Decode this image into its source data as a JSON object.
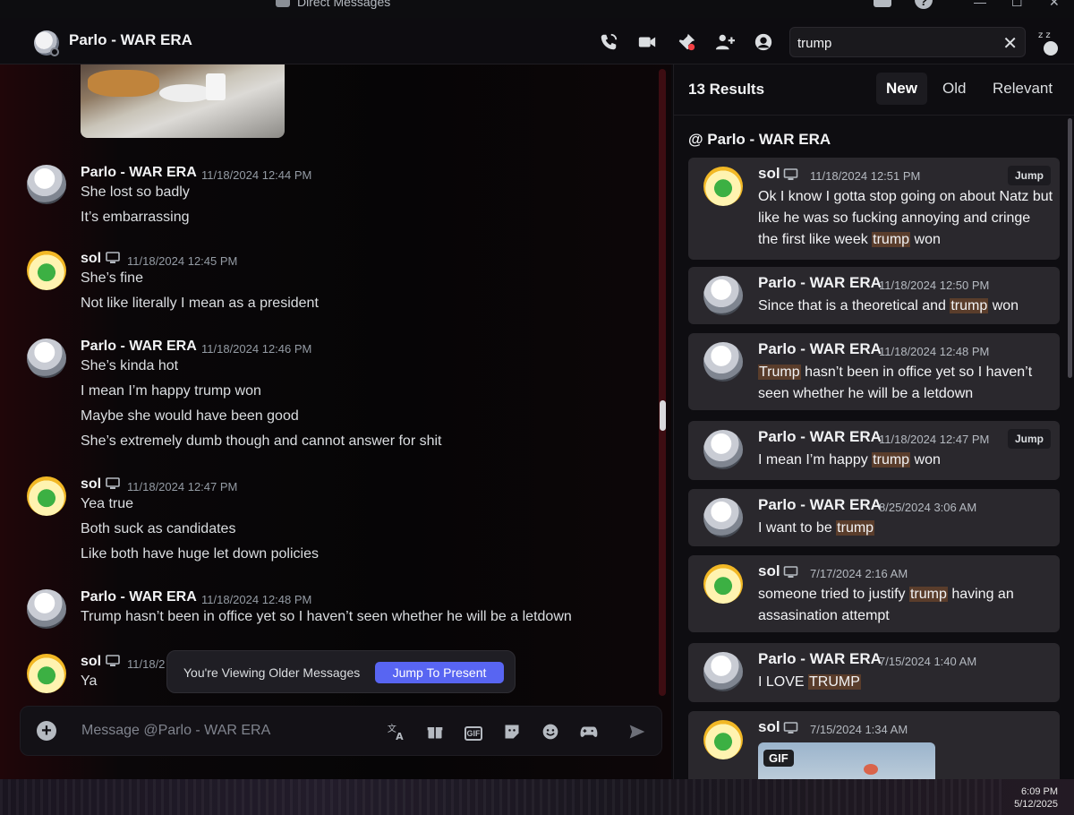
{
  "os": {
    "window_title": "Direct Messages",
    "minimize": "—",
    "maximize": "☐",
    "close": "✕"
  },
  "header": {
    "dm_name": "Parlo - WAR ERA",
    "search_value": "trump",
    "search_clear": "✕"
  },
  "chat": {
    "groups": [
      {
        "author": "Parlo - WAR ERA",
        "timestamp": "11/18/2024 12:44 PM",
        "avatar": "parlo",
        "has_pc_icon": false,
        "lines": [
          "She lost so badly",
          "It’s embarrassing"
        ]
      },
      {
        "author": "sol",
        "timestamp": "11/18/2024 12:45 PM",
        "avatar": "sol",
        "has_pc_icon": true,
        "lines": [
          "She’s fine",
          "Not like literally I mean as a president"
        ]
      },
      {
        "author": "Parlo - WAR ERA",
        "timestamp": "11/18/2024 12:46 PM",
        "avatar": "parlo",
        "has_pc_icon": false,
        "lines": [
          "She’s kinda hot",
          "I mean I’m happy trump won",
          "Maybe she would have been good",
          "She’s extremely dumb though and cannot answer for shit"
        ]
      },
      {
        "author": "sol",
        "timestamp": "11/18/2024 12:47 PM",
        "avatar": "sol",
        "has_pc_icon": true,
        "lines": [
          "Yea true",
          "Both suck as candidates",
          "Like both have huge let down policies"
        ]
      },
      {
        "author": "Parlo - WAR ERA",
        "timestamp": "11/18/2024 12:48 PM",
        "avatar": "parlo",
        "has_pc_icon": false,
        "lines": [
          "Trump hasn’t been in office yet so I haven’t seen whether he will be a letdown"
        ]
      },
      {
        "author": "sol",
        "timestamp": "11/18/2",
        "avatar": "sol",
        "has_pc_icon": true,
        "lines": [
          "Ya"
        ]
      }
    ],
    "older_notice": "You're Viewing Older Messages",
    "jump_to_present": "Jump To Present",
    "composer_placeholder": "Message @Parlo - WAR ERA",
    "gif_label": "GIF"
  },
  "search_results": {
    "count_label": "13 Results",
    "tabs": [
      "New",
      "Old",
      "Relevant"
    ],
    "active_tab": "New",
    "channel_label": "@ Parlo - WAR ERA",
    "jump_label": "Jump",
    "gif_label": "GIF",
    "results": [
      {
        "author": "sol",
        "timestamp": "11/18/2024 12:51 PM",
        "avatar": "sol",
        "has_pc_icon": true,
        "jump": true,
        "segments": [
          {
            "text": "Ok I know I gotta stop going on about Natz but like he was so fucking annoying and cringe the first like week ",
            "hl": false
          },
          {
            "text": "trump",
            "hl": true
          },
          {
            "text": " won",
            "hl": false
          }
        ]
      },
      {
        "author": "Parlo - WAR ERA",
        "timestamp": "11/18/2024 12:50 PM",
        "avatar": "parlo",
        "has_pc_icon": false,
        "jump": false,
        "segments": [
          {
            "text": "Since that is a theoretical and ",
            "hl": false
          },
          {
            "text": "trump",
            "hl": true
          },
          {
            "text": " won",
            "hl": false
          }
        ]
      },
      {
        "author": "Parlo - WAR ERA",
        "timestamp": "11/18/2024 12:48 PM",
        "avatar": "parlo",
        "has_pc_icon": false,
        "jump": false,
        "segments": [
          {
            "text": "Trump",
            "hl": true
          },
          {
            "text": " hasn’t been in office yet so I haven’t seen whether he will be a letdown",
            "hl": false
          }
        ]
      },
      {
        "author": "Parlo - WAR ERA",
        "timestamp": "11/18/2024 12:47 PM",
        "avatar": "parlo",
        "has_pc_icon": false,
        "jump": true,
        "segments": [
          {
            "text": "I mean I’m happy ",
            "hl": false
          },
          {
            "text": "trump",
            "hl": true
          },
          {
            "text": " won",
            "hl": false
          }
        ]
      },
      {
        "author": "Parlo - WAR ERA",
        "timestamp": "8/25/2024 3:06 AM",
        "avatar": "parlo",
        "has_pc_icon": false,
        "jump": false,
        "segments": [
          {
            "text": "I want to be ",
            "hl": false
          },
          {
            "text": "trump",
            "hl": true
          }
        ]
      },
      {
        "author": "sol",
        "timestamp": "7/17/2024 2:16 AM",
        "avatar": "sol",
        "has_pc_icon": true,
        "jump": false,
        "segments": [
          {
            "text": "someone tried to justify ",
            "hl": false
          },
          {
            "text": "trump",
            "hl": true
          },
          {
            "text": " having an assasination attempt",
            "hl": false
          }
        ]
      },
      {
        "author": "Parlo - WAR ERA",
        "timestamp": "7/15/2024 1:40 AM",
        "avatar": "parlo",
        "has_pc_icon": false,
        "jump": false,
        "segments": [
          {
            "text": "I LOVE ",
            "hl": false
          },
          {
            "text": "TRUMP",
            "hl": true
          }
        ]
      },
      {
        "author": "sol",
        "timestamp": "7/15/2024 1:34 AM",
        "avatar": "sol",
        "has_pc_icon": true,
        "jump": false,
        "gif": true,
        "segments": []
      }
    ]
  },
  "taskbar": {
    "time": "6:09 PM",
    "date": "5/12/2025"
  },
  "colors": {
    "accent": "#5865f2",
    "highlight": "#5a3d2b",
    "card_bg": "#2a282d"
  }
}
